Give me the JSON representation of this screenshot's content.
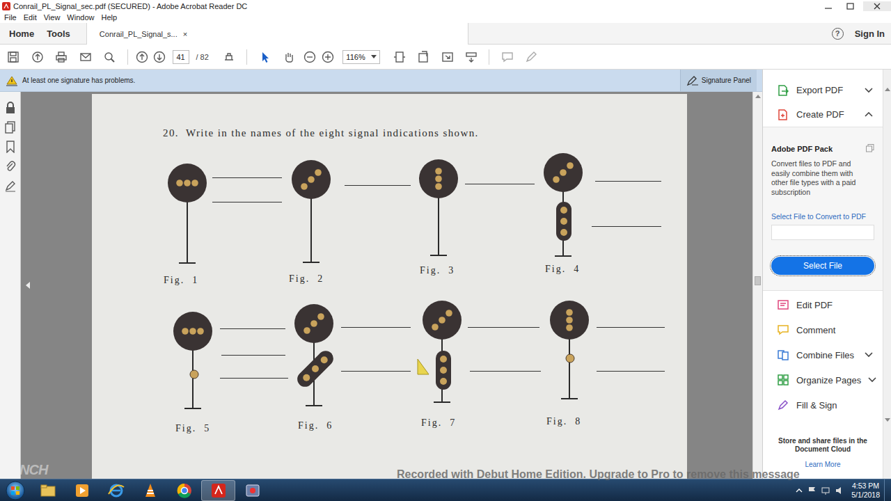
{
  "window": {
    "title": "Conrail_PL_Signal_sec.pdf (SECURED) - Adobe Acrobat Reader DC"
  },
  "menu": [
    "File",
    "Edit",
    "View",
    "Window",
    "Help"
  ],
  "tabs": [
    {
      "label": "Home",
      "selected": false
    },
    {
      "label": "Tools",
      "selected": false
    },
    {
      "label": "Conrail_PL_Signal_s...",
      "selected": true,
      "close": "×"
    }
  ],
  "help": "?",
  "sign_in": "Sign In",
  "toolbar": {
    "page": "41",
    "page_count": "/ 82",
    "zoom": "116%",
    "select_tool_active": true
  },
  "notification": {
    "message": "At least one signature has problems.",
    "button": "Signature Panel"
  },
  "document": {
    "question": "20.  Write in the names of the eight signal indications shown.",
    "scroll_level": 0.49,
    "figures": [
      {
        "label": "Fig.  1",
        "head": {
          "kind": "horizontal"
        },
        "lines": 2,
        "note": false
      },
      {
        "label": "Fig.  2",
        "head": {
          "kind": "diagonal"
        },
        "lines": 1,
        "note": false
      },
      {
        "label": "Fig.  3",
        "head": {
          "kind": "vertical"
        },
        "lines": 1,
        "note": false
      },
      {
        "label": "Fig.  4",
        "head": {
          "kind": "diagonal"
        },
        "lower": {
          "kind": "vertical"
        },
        "lines": 2,
        "note": false
      },
      {
        "label": "Fig.  5",
        "head": {
          "kind": "horizontal"
        },
        "lower": {
          "kind": "dot"
        },
        "lines": 3,
        "note": false
      },
      {
        "label": "Fig.  6",
        "head": {
          "kind": "diagonal"
        },
        "lower": {
          "kind": "diagonal"
        },
        "lines": 2,
        "note": false
      },
      {
        "label": "Fig.  7",
        "head": {
          "kind": "diagonal"
        },
        "lower": {
          "kind": "vertical"
        },
        "lines": 2,
        "note": true
      },
      {
        "label": "Fig.  8",
        "head": {
          "kind": "vertical"
        },
        "lower": {
          "kind": "dot"
        },
        "lines": 2,
        "note": false
      }
    ]
  },
  "right_pane": {
    "top_tools": [
      {
        "label": "Export PDF",
        "expanded": false
      },
      {
        "label": "Create PDF",
        "expanded": true
      }
    ],
    "pack": {
      "title": "Adobe PDF Pack",
      "description": "Convert files to PDF and easily combine them with other file types with a paid subscription",
      "field_label": "Select File to Convert to PDF",
      "button": "Select File"
    },
    "tools": [
      {
        "label": "Edit PDF",
        "kind": "plain"
      },
      {
        "label": "Comment",
        "kind": "plain"
      },
      {
        "label": "Combine Files",
        "kind": "menu"
      },
      {
        "label": "Organize Pages",
        "kind": "menu"
      },
      {
        "label": "Fill & Sign",
        "kind": "plain"
      }
    ],
    "footer": {
      "text": "Store and share files in the Document Cloud",
      "link": "Learn More"
    }
  },
  "taskbar": {
    "apps": [
      {
        "selected": false
      },
      {
        "selected": false
      },
      {
        "selected": false
      },
      {
        "selected": false
      },
      {
        "selected": false
      },
      {
        "selected": true
      },
      {
        "selected": false
      }
    ],
    "time": "4:53 PM",
    "date": "5/1/2018"
  },
  "watermark": {
    "text": "Recorded with Debut Home Edition. Upgrade to Pro to remove this message",
    "logo": "NCH"
  }
}
